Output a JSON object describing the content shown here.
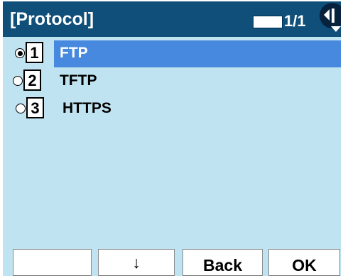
{
  "header": {
    "title": "[Protocol]",
    "page": "1/1"
  },
  "colors": {
    "title_bar": "#0f4f79",
    "screen_bg": "#bfe3f1",
    "highlight": "#4689de"
  },
  "menu": {
    "items": [
      {
        "number": "1",
        "label": "FTP",
        "selected": true
      },
      {
        "number": "2",
        "label": "TFTP",
        "selected": false
      },
      {
        "number": "3",
        "label": "HTTPS",
        "selected": false
      }
    ]
  },
  "softkeys": {
    "key1": "",
    "key2": "↓",
    "key3": "Back",
    "key4": "OK"
  },
  "icons": {
    "navigation": "nav-left-down-icon"
  }
}
